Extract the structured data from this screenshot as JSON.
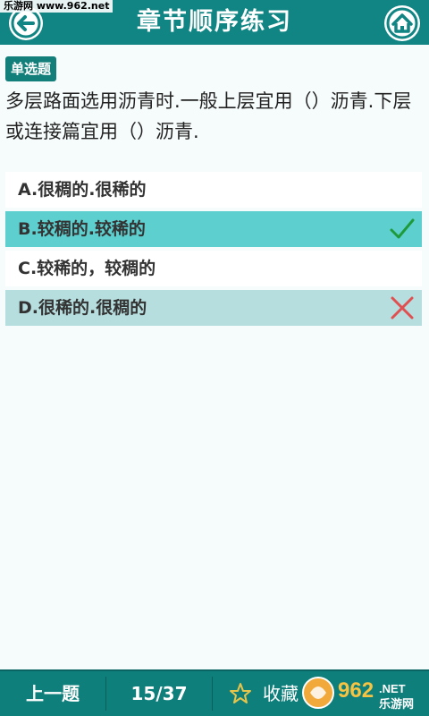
{
  "watermark": "乐游网 www.962.net",
  "header": {
    "title": "章节顺序练习"
  },
  "question": {
    "type_badge": "单选题",
    "text": "多层路面选用沥青时.一般上层宜用（）沥青.下层或连接篇宜用（）沥青."
  },
  "options": [
    {
      "label": "A.",
      "text": "很稠的.很稀的",
      "state": "normal"
    },
    {
      "label": "B.",
      "text": "较稠的.较稀的",
      "state": "correct"
    },
    {
      "label": "C.",
      "text": "较稀的，较稠的",
      "state": "normal"
    },
    {
      "label": "D.",
      "text": "很稀的.很稠的",
      "state": "wrong"
    }
  ],
  "bottom": {
    "prev_label": "上一题",
    "progress": "15/37",
    "favorite_label": "收藏"
  },
  "logo": {
    "number": "962",
    "suffix": ".NET",
    "text": "乐游网"
  },
  "colors": {
    "header": "#118583",
    "correct": "#5ecfcf",
    "wrong": "#b7dede",
    "check": "#1e9a3a",
    "cross": "#e05050"
  }
}
